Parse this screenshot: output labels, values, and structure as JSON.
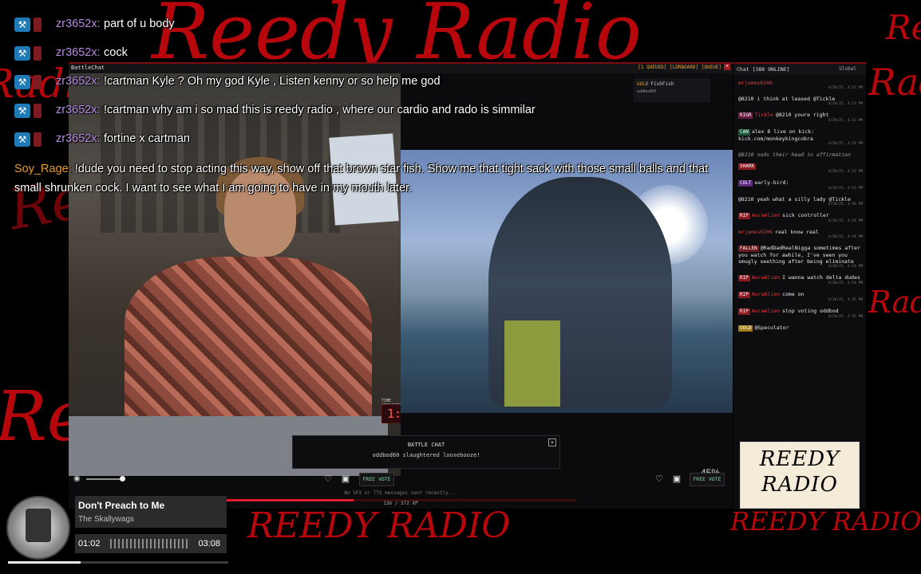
{
  "background": {
    "scribbles": [
      "Reedy Radio",
      "Reedy Radio",
      "REEDY RADIO",
      "REEDY RADIO",
      "Radio",
      "Radi",
      "Reedy",
      "Ree",
      "Rei",
      "Radio"
    ],
    "accent_color": "#c8070f"
  },
  "overlay_chat": {
    "messages": [
      {
        "user": "zr3652x:",
        "text": "part of u body"
      },
      {
        "user": "zr3652x:",
        "text": "cock"
      },
      {
        "user": "zr3652x:",
        "text": "!cartman Kyle ? Oh my god Kyle , Listen kenny or so help me god"
      },
      {
        "user": "zr3652x:",
        "text": "!cartman why am i so mad this is reedy radio , where our cardio and rado is simmilar"
      },
      {
        "user": "zr3652x:",
        "text": "fortine x cartman"
      }
    ],
    "highlight": {
      "user": "Soy_Rage:",
      "text": "!dude you need to stop acting this way, show off that brown star fish. Show me that tight sack with those small balls and that small shrunken cock. I want to see what I am going to have in my mouth later."
    }
  },
  "battle_window": {
    "title": "BattleChat",
    "tabs_right": "[1 QUEUED] [LDRBOARD] [QUEUE]",
    "close": "×",
    "timer_label": "TIME REMAINING",
    "timer": "1:20",
    "mini_box": {
      "badge": "GOLD",
      "name": "FishFish",
      "sub": "oddbod60"
    },
    "battle_chat": {
      "header": "BATTLE CHAT",
      "message": "oddbod60 slaughtered loosebooze!",
      "close": "×"
    },
    "right_percent": "45%",
    "free_vote_label": "FREE VOTE",
    "status_line": "No SFX or TTS messages sent recently...",
    "xp_text": "136 / 372 XP",
    "xp_fraction": 0.365
  },
  "chat_panel": {
    "title": "Chat [388 ONLINE]",
    "scope": "Global",
    "messages": [
      {
        "badge": "",
        "user": "mrjames0206",
        "text": "",
        "time": "4/28/25, 4:52 PM"
      },
      {
        "badge": "",
        "user": "",
        "text": "@8210 i think at leased @Tickle",
        "time": "4/28/25, 4:53 PM"
      },
      {
        "badge": "RIGR",
        "user": "Tickle",
        "text": "@8210 youre right",
        "time": "4/28/25, 4:53 PM"
      },
      {
        "badge": "CAN",
        "user": "",
        "text": "alex 8 live on kick: kick.com/monkeykingcobra",
        "time": "4/28/25, 4:53 PM"
      },
      {
        "badge": "",
        "user": "",
        "text": "@8210 nods their head in affirmation",
        "time": "",
        "sys": true
      },
      {
        "badge": "SHARK",
        "user": "",
        "text": "",
        "time": "4/28/25, 4:53 PM"
      },
      {
        "badge": "COLT",
        "user": "",
        "text": "early-bird:",
        "time": "4/28/25, 4:53 PM"
      },
      {
        "badge": "",
        "user": "",
        "text": "@8210 yeah what a silly lady @Tickle",
        "time": "4/28/25, 4:54 PM"
      },
      {
        "badge": "RIP",
        "user": "AuraAlien",
        "text": "sick controller",
        "time": "4/28/25, 4:54 PM"
      },
      {
        "badge": "",
        "user": "mrjames0206",
        "text": "real know real",
        "time": "4/28/25, 4:54 PM"
      },
      {
        "badge": "FALLEN",
        "user": "",
        "text": "@RadDadRealNigga sometimes after you watch for awhile, I've seen you smugly seething after being eliminate",
        "time": "4/28/25, 4:54 PM"
      },
      {
        "badge": "RIP",
        "user": "AuraAlien",
        "text": "I wanna watch delta dudes",
        "time": "4/28/25, 4:54 PM"
      },
      {
        "badge": "RIP",
        "user": "AuraAlien",
        "text": "come on",
        "time": "4/28/25, 4:55 PM"
      },
      {
        "badge": "RIP",
        "user": "AuraAlien",
        "text": "stop voting oddbod",
        "time": "4/28/25, 4:55 PM"
      },
      {
        "badge": "GOLD",
        "user": "",
        "text": "@Speculator",
        "time": ""
      }
    ],
    "logo_line1": "REEDY",
    "logo_line2": "RADIO"
  },
  "music": {
    "song": "Don't Preach to Me",
    "artist": "The Skallywags",
    "elapsed": "01:02",
    "duration": "03:08",
    "progress_fraction": 0.33
  }
}
